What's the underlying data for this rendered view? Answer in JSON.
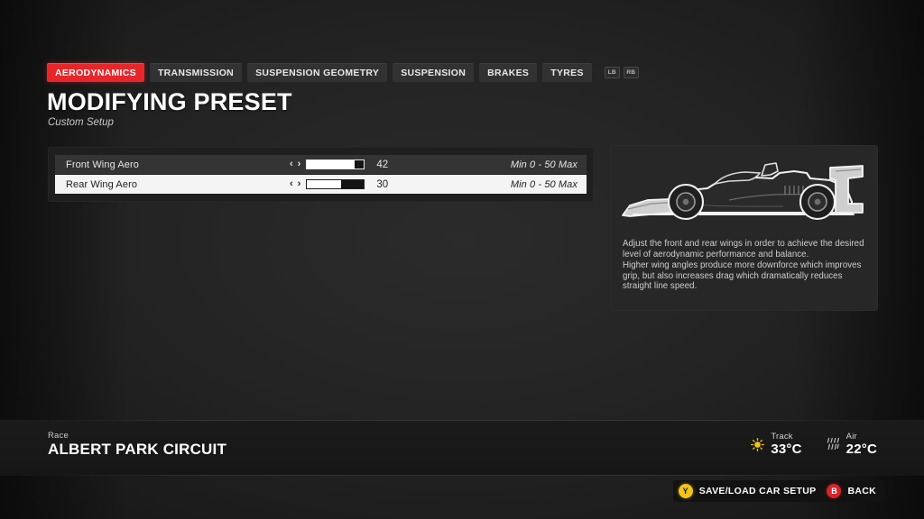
{
  "tabs": [
    {
      "label": "AERODYNAMICS",
      "active": true
    },
    {
      "label": "TRANSMISSION",
      "active": false
    },
    {
      "label": "SUSPENSION GEOMETRY",
      "active": false
    },
    {
      "label": "SUSPENSION",
      "active": false
    },
    {
      "label": "BRAKES",
      "active": false
    },
    {
      "label": "TYRES",
      "active": false
    }
  ],
  "bumpers": [
    {
      "label": "LB"
    },
    {
      "label": "RB"
    }
  ],
  "header": {
    "title": "MODIFYING PRESET",
    "subtitle": "Custom Setup"
  },
  "settings": {
    "rows": [
      {
        "label": "Front Wing Aero",
        "value": "42",
        "value_number": 42,
        "min": 0,
        "max": 50,
        "fill_percent": 84,
        "range_text": "Min 0 - 50 Max",
        "left_arrow": "‹",
        "right_arrow": "›",
        "selected": false
      },
      {
        "label": "Rear Wing Aero",
        "value": "30",
        "value_number": 30,
        "min": 0,
        "max": 50,
        "fill_percent": 60,
        "range_text": "Min 0 - 50 Max",
        "left_arrow": "‹",
        "right_arrow": "›",
        "selected": true
      }
    ]
  },
  "info": {
    "car_icon": "f1-car-side-outline-icon",
    "paragraphs": [
      "Adjust the front and rear wings in order to achieve the desired level of aerodynamic performance and balance.",
      "Higher wing angles produce more downforce which improves grip, but also increases drag which dramatically reduces straight line speed."
    ]
  },
  "footer": {
    "race_kicker": "Race",
    "race_name": "ALBERT PARK CIRCUIT",
    "weather": [
      {
        "label": "Track",
        "value": "33°C",
        "icon": "sun-icon"
      },
      {
        "label": "Air",
        "value": "22°C",
        "icon": "wind-icon"
      }
    ]
  },
  "actions": [
    {
      "glyph": "Y",
      "label": "SAVE/LOAD CAR SETUP",
      "color": "#f2c416"
    },
    {
      "glyph": "B",
      "label": "BACK",
      "color": "#d6242b"
    }
  ],
  "colors": {
    "accent_red": "#e8262a",
    "button_yellow": "#f2c416",
    "button_red": "#d6242b",
    "selected_row_bg": "#f4f4f4",
    "row_bg": "#353434"
  }
}
